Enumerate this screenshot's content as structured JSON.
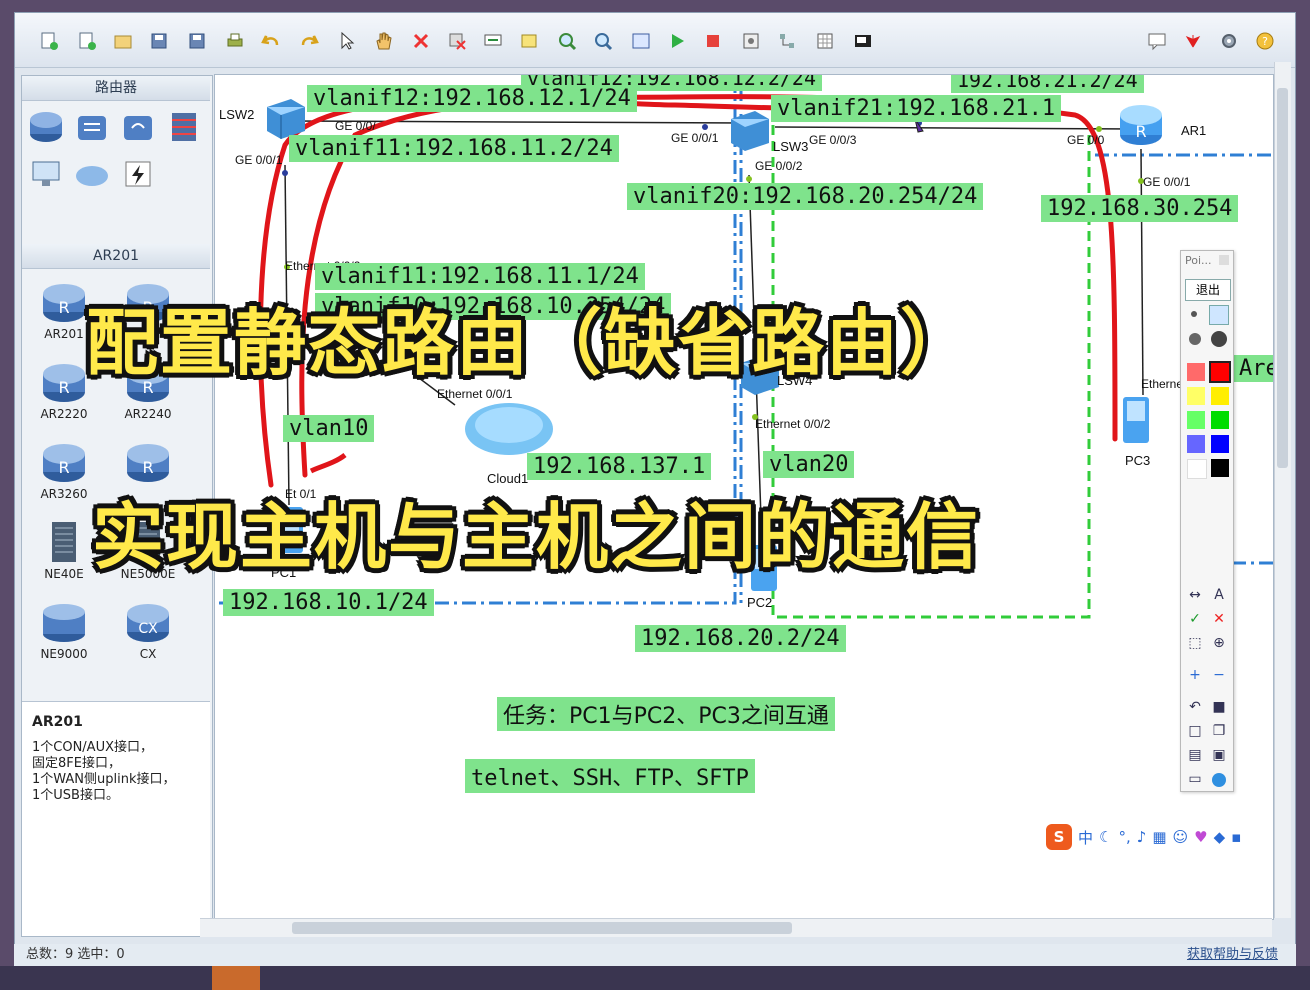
{
  "toolbar": {
    "icons": [
      "new-topo-icon",
      "new-device-icon",
      "open-icon",
      "save-icon",
      "save-as-icon",
      "print-icon",
      "undo-icon",
      "redo-icon",
      "select-icon",
      "hand-icon",
      "delete-icon",
      "delete-link-icon",
      "text-icon",
      "rect-icon",
      "zoom-in-icon",
      "zoom-out-icon",
      "fit-icon",
      "start-icon",
      "stop-icon",
      "capture-icon",
      "topo-icon",
      "grid-icon",
      "screenshot-icon"
    ],
    "right_icons": [
      "chat-icon",
      "huawei-icon",
      "settings-icon",
      "help-icon"
    ]
  },
  "left": {
    "section1_title": "路由器",
    "section2_title": "AR201",
    "devices": [
      {
        "name": "AR201"
      },
      {
        "name": "AR2220"
      },
      {
        "name": "AR2240"
      },
      {
        "name": "AR3260"
      },
      {
        "name": "NE40E"
      },
      {
        "name": "NE5000E"
      },
      {
        "name": "NE9000"
      },
      {
        "name": "CX"
      }
    ],
    "desc_title": "AR201",
    "desc_lines": [
      "1个CON/AUX接口，",
      "固定8FE接口，",
      "1个WAN侧uplink接口，",
      "1个USB接口。"
    ]
  },
  "canvas": {
    "labels": {
      "vlanif12": "vlanif12:192.168.12.1/24",
      "vlanif11a": "vlanif11:192.168.11.2/24",
      "vlanif21": "vlanif21:192.168.21.1",
      "vlanif20": "vlanif20:192.168.20.254/24",
      "net30": "192.168.30.254",
      "vlanif11b": "vlanif11:192.168.11.1/24",
      "vlanif10": "vlanif10:192.168.10.254/24",
      "vlan10": "vlan10",
      "vlan20": "vlan20",
      "net137": "192.168.137.1",
      "pc1ip": "192.168.10.1/24",
      "pc2ip": "192.168.20.2/24",
      "top1": "vlanif12:192.168.12.2/24",
      "top2": "192.168.21.2/24",
      "area": "Are",
      "task": "任务：PC1与PC2、PC3之间互通",
      "proto": "telnet、SSH、FTP、SFTP"
    },
    "devices": {
      "lsw2": "LSW2",
      "lsw3": "LSW3",
      "lsw4": "LSW4",
      "ar1": "AR1",
      "pc1": "PC1",
      "pc2": "PC2",
      "pc3": "PC3",
      "cloud1": "Cloud1"
    },
    "ports": {
      "ge001a": "GE 0/0/1",
      "ge00": "GE 0/0/",
      "ge001b": "GE 0/0/1",
      "ge003": "GE 0/0/3",
      "ge002": "GE 0/0/2",
      "ge00r": "GE 0/0",
      "ge001c": "GE 0/0/1",
      "eth002": "Ethernet 0/0/2",
      "eth001": "Ethernet 0/0/1",
      "eth002b": "Ethernet 0/0/2",
      "ethr": "Etherne",
      "et01": "Et    0/1"
    },
    "overlay": {
      "line1": "配置静态路由（缺省路由）",
      "line2": "实现主机与主机之间的通信"
    }
  },
  "palette": {
    "title": "Poi...",
    "exit": "退出",
    "colors": [
      "#ff6a6a",
      "#ff0000",
      "#ffff66",
      "#ffee00",
      "#66ff66",
      "#00dd00",
      "#6666ff",
      "#0000ff",
      "#ffffff",
      "#000000"
    ]
  },
  "ime": {
    "logo": "S",
    "mode": "中"
  },
  "status": {
    "left": "总数：9  选中：0",
    "right": "获取帮助与反馈"
  },
  "colors": {
    "label_bg": "#7fe38c",
    "overlay": "#ffe94a",
    "red_line": "#e0151a"
  }
}
